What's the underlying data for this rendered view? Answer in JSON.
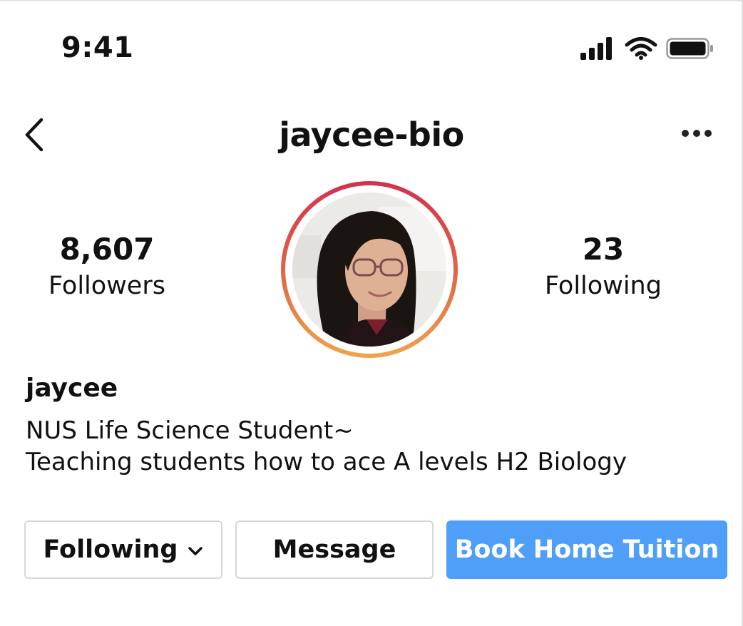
{
  "status_bar": {
    "time": "9:41",
    "icons": [
      "cellular-signal-icon",
      "wifi-icon",
      "battery-icon"
    ]
  },
  "header": {
    "title": "jaycee-bio",
    "back_icon": "chevron-left-icon",
    "more_icon": "ellipsis-icon"
  },
  "profile": {
    "followers_count": "8,607",
    "followers_label": "Followers",
    "following_count": "23",
    "following_label": "Following",
    "avatar_icon": "profile-photo",
    "display_name": "jaycee",
    "bio_lines": [
      "NUS Life Science Student~",
      "Teaching students how to ace A levels H2 Biology"
    ]
  },
  "actions": {
    "following_label": "Following",
    "message_label": "Message",
    "book_label": "Book Home Tuition"
  },
  "colors": {
    "primary_button": "#4f9ff8",
    "story_ring_top": "#d3304f",
    "story_ring_bottom": "#f0a44d",
    "button_border": "#d6d6d6"
  }
}
